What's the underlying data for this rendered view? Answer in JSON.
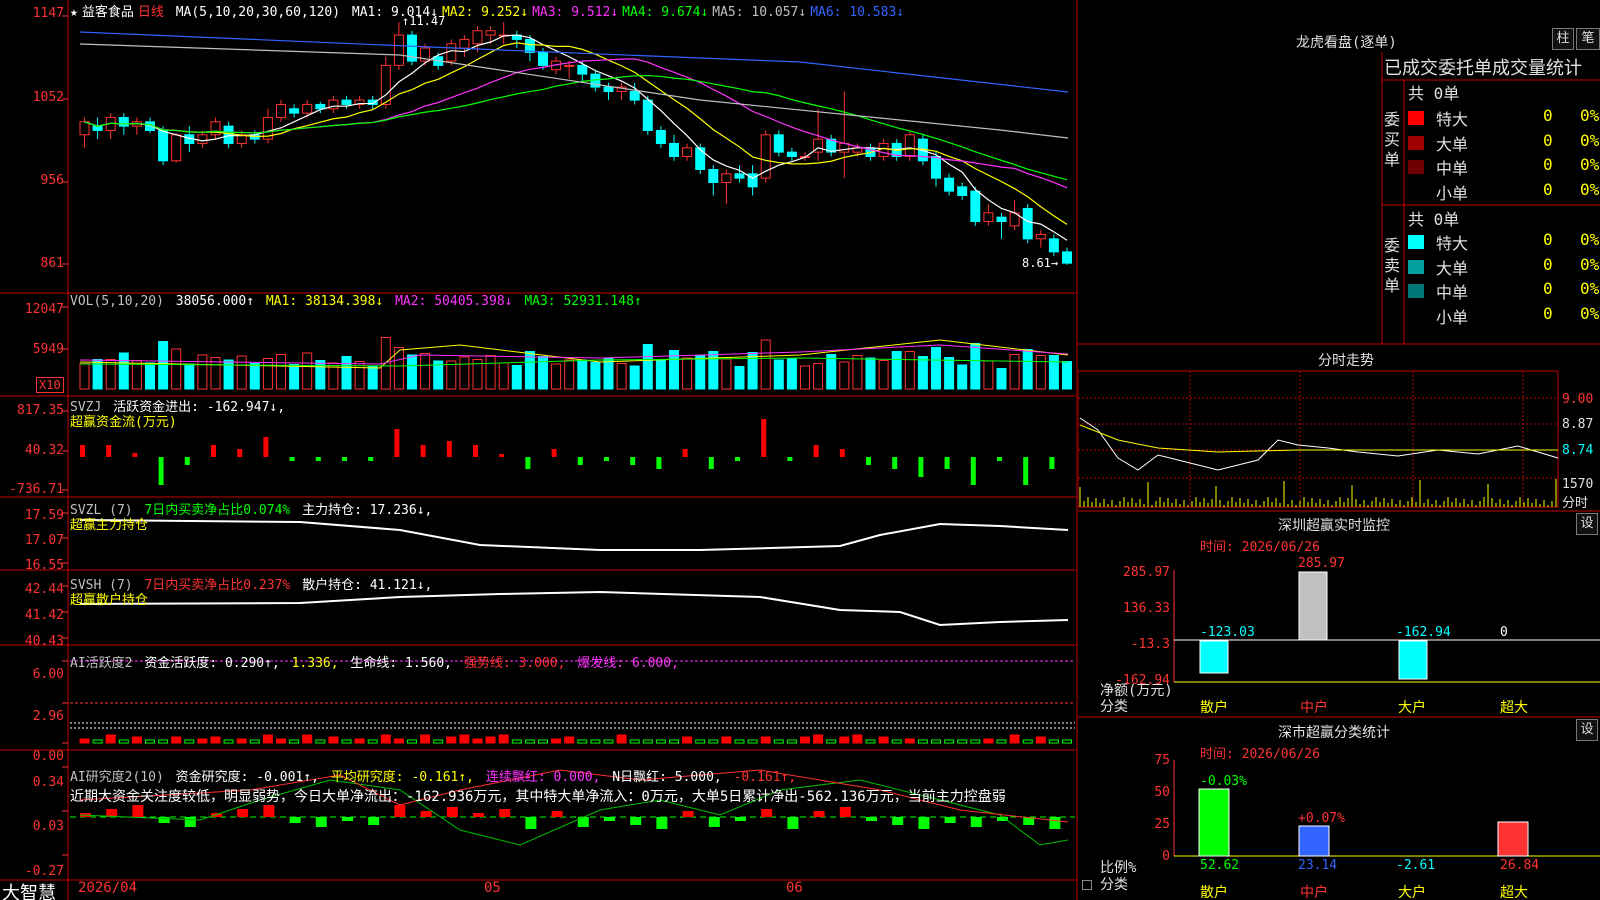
{
  "main_header": {
    "star": "★",
    "stock_name": "益客食品",
    "period": "日线",
    "ma_label": "MA(5,10,20,30,60,120)",
    "ma": [
      {
        "text": "MA1: 9.014↓",
        "color": "#ffffff"
      },
      {
        "text": "MA2: 9.252↓",
        "color": "#ffff00"
      },
      {
        "text": "MA3: 9.512↓",
        "color": "#ff32ff"
      },
      {
        "text": "MA4: 9.674↓",
        "color": "#00ff00"
      },
      {
        "text": "MA5: 10.057↓",
        "color": "#c0c0c0"
      },
      {
        "text": "MA6: 10.583↓",
        "color": "#3264ff"
      }
    ],
    "high_marker": "11.47",
    "low_marker": "8.61"
  },
  "price_axis": [
    "1147",
    "1052",
    "956",
    "861"
  ],
  "vol_panel": {
    "label": "VOL(5,10,20)",
    "value": "38056.000↑",
    "ma1": "MA1: 38134.398↓",
    "ma2": "MA2: 50405.398↓",
    "ma3": "MA3: 52931.148↑",
    "axis": [
      "12047",
      "5949"
    ],
    "unit": "X10"
  },
  "svzj_panel": {
    "label": "SVZJ",
    "title": "活跃资金进出: -162.947↓,",
    "subtitle": "超赢资金流(万元)",
    "axis": [
      "817.35",
      "40.32",
      "-736.71"
    ]
  },
  "svzl_panel": {
    "label": "SVZL (7)",
    "ratio": "7日内买卖净占比0.074%",
    "hold": "主力持仓: 17.236↓,",
    "subtitle": "超赢主力持仓",
    "axis": [
      "17.59",
      "17.07",
      "16.55"
    ]
  },
  "svsh_panel": {
    "label": "SVSH (7)",
    "ratio": "7日内买卖净占比0.237%",
    "hold": "散户持仓: 41.121↓,",
    "subtitle": "超赢散户持仓",
    "axis": [
      "42.44",
      "41.42",
      "40.43"
    ]
  },
  "ai_active_panel": {
    "label": "AI活跃度2",
    "active": "资金活跃度: 0.290↑,",
    "v2": "1.336,",
    "life": "生命线: 1.560,",
    "strong": "强势线: 3.000,",
    "burst": "爆发线: 6.000,",
    "axis": [
      "6.00",
      "2.96",
      "0.00"
    ]
  },
  "ai_research_panel": {
    "label": "AI研究度2(10)",
    "research": "资金研究度: -0.001↑,",
    "avg": "平均研究度: -0.161↑,",
    "cont": "连续飘红: 0.000,",
    "nday": "N日飘红: 5.000,",
    "last": "-0.161↑,",
    "comment": "近期大资金关注度较低，明显弱势，今日大单净流出：-162.936万元，其中特大单净流入：0万元，大单5日累计净出-562.136万元，当前主力控盘弱",
    "axis": [
      "0.34",
      "0.03",
      "-0.27"
    ]
  },
  "bottom_bar": {
    "brand": "大智慧",
    "date_label": "2026/04",
    "months": [
      "05",
      "06"
    ]
  },
  "right_panel": {
    "longhu_title": "龙虎看盘(逐单)",
    "btn_bar": "柱",
    "btn_pen": "笔",
    "table_header": "已成交委托单成交量统计",
    "buy_side": {
      "label": "委买单",
      "total": "共 0单",
      "rows": [
        {
          "name": "特大",
          "v": "0",
          "pct": "0%",
          "color": "#ff0000"
        },
        {
          "name": "大单",
          "v": "0",
          "pct": "0%",
          "color": "#a00000"
        },
        {
          "name": "中单",
          "v": "0",
          "pct": "0%",
          "color": "#700000"
        },
        {
          "name": "小单",
          "v": "0",
          "pct": "0%",
          "color": "#000000"
        }
      ]
    },
    "sell_side": {
      "label": "委卖单",
      "total": "共 0单",
      "rows": [
        {
          "name": "特大",
          "v": "0",
          "pct": "0%",
          "color": "#00ffff"
        },
        {
          "name": "大单",
          "v": "0",
          "pct": "0%",
          "color": "#00a0a0"
        },
        {
          "name": "中单",
          "v": "0",
          "pct": "0%",
          "color": "#007878"
        },
        {
          "name": "小单",
          "v": "0",
          "pct": "0%",
          "color": "#000000"
        }
      ]
    },
    "intraday_title": "分时走势",
    "intraday_axis": [
      "9.00",
      "8.87",
      "8.74"
    ],
    "intraday_vol": "1570",
    "intraday_vol_unit": "分时",
    "monitor_title": "深圳超赢实时监控",
    "monitor_btn": "设",
    "monitor_time": "时间: 2026/06/26",
    "monitor_axis": [
      "285.97",
      "136.33",
      "-13.3",
      "-162.94"
    ],
    "monitor_values": [
      {
        "label": "-123.03",
        "color": "#00ffff"
      },
      {
        "label": "285.97",
        "color": "#ff3232"
      },
      {
        "label": "-162.94",
        "color": "#00ffff"
      },
      {
        "label": "0",
        "color": "#ffffff"
      }
    ],
    "monitor_ylabel": "净额(万元)",
    "monitor_xlabel": "分类",
    "categories": [
      {
        "name": "散户",
        "color": "#ffff00"
      },
      {
        "name": "中户",
        "color": "#ff3232"
      },
      {
        "name": "大户",
        "color": "#ffff00"
      },
      {
        "name": "超大",
        "color": "#ffff00"
      }
    ],
    "stats_title": "深市超赢分类统计",
    "stats_btn": "设",
    "stats_time": "时间: 2026/06/26",
    "stats_axis": [
      "75",
      "50",
      "25",
      "0"
    ],
    "stats_top": [
      {
        "label": "-0.03%",
        "color": "#00ff00"
      },
      {
        "label": "+0.07%",
        "color": "#ff3232"
      }
    ],
    "stats_values": [
      {
        "label": "52.62",
        "color": "#00ff00"
      },
      {
        "label": "23.14",
        "color": "#3264ff"
      },
      {
        "label": "-2.61",
        "color": "#00ffff"
      },
      {
        "label": "26.84",
        "color": "#ff3232"
      }
    ],
    "stats_ylabel": "比例%",
    "stats_xlabel": "分类"
  },
  "chart_data": {
    "type": "candlestick",
    "note_series": "daily OHLC (price units, x100 axis)",
    "candles": [
      [
        1010,
        1025,
        995,
        1030
      ],
      [
        1020,
        1015,
        1005,
        1030
      ],
      [
        1015,
        1030,
        1005,
        1035
      ],
      [
        1030,
        1020,
        1010,
        1035
      ],
      [
        1020,
        1025,
        1010,
        1030
      ],
      [
        1025,
        1015,
        1012,
        1030
      ],
      [
        1015,
        980,
        975,
        1020
      ],
      [
        980,
        1010,
        978,
        1012
      ],
      [
        1010,
        1000,
        990,
        1020
      ],
      [
        1000,
        1010,
        995,
        1015
      ],
      [
        1010,
        1025,
        1005,
        1030
      ],
      [
        1020,
        1000,
        995,
        1025
      ],
      [
        1000,
        1010,
        995,
        1015
      ],
      [
        1010,
        1005,
        1000,
        1015
      ],
      [
        1005,
        1030,
        1000,
        1040
      ],
      [
        1030,
        1045,
        1025,
        1050
      ],
      [
        1040,
        1035,
        1030,
        1045
      ],
      [
        1035,
        1045,
        1030,
        1050
      ],
      [
        1045,
        1040,
        1035,
        1048
      ],
      [
        1040,
        1050,
        1035,
        1055
      ],
      [
        1050,
        1045,
        1040,
        1055
      ],
      [
        1045,
        1050,
        1040,
        1055
      ],
      [
        1050,
        1045,
        1040,
        1055
      ],
      [
        1045,
        1090,
        1040,
        1100
      ],
      [
        1090,
        1125,
        1085,
        1140
      ],
      [
        1125,
        1095,
        1090,
        1130
      ],
      [
        1095,
        1110,
        1090,
        1115
      ],
      [
        1100,
        1090,
        1085,
        1105
      ],
      [
        1095,
        1115,
        1090,
        1120
      ],
      [
        1110,
        1120,
        1100,
        1125
      ],
      [
        1115,
        1130,
        1105,
        1135
      ],
      [
        1125,
        1130,
        1115,
        1135
      ],
      [
        1125,
        1125,
        1115,
        1140
      ],
      [
        1125,
        1120,
        1110,
        1130
      ],
      [
        1120,
        1105,
        1095,
        1125
      ],
      [
        1105,
        1090,
        1085,
        1110
      ],
      [
        1085,
        1095,
        1080,
        1100
      ],
      [
        1090,
        1090,
        1075,
        1095
      ],
      [
        1090,
        1080,
        1070,
        1095
      ],
      [
        1080,
        1065,
        1060,
        1085
      ],
      [
        1065,
        1060,
        1050,
        1070
      ],
      [
        1060,
        1065,
        1050,
        1070
      ],
      [
        1060,
        1050,
        1045,
        1070
      ],
      [
        1050,
        1015,
        1010,
        1055
      ],
      [
        1015,
        1000,
        995,
        1020
      ],
      [
        1000,
        985,
        980,
        1010
      ],
      [
        985,
        995,
        980,
        1000
      ],
      [
        995,
        970,
        965,
        1000
      ],
      [
        970,
        955,
        940,
        975
      ],
      [
        955,
        965,
        930,
        970
      ],
      [
        965,
        960,
        955,
        975
      ],
      [
        965,
        950,
        940,
        975
      ],
      [
        960,
        1010,
        955,
        1015
      ],
      [
        1010,
        990,
        985,
        1015
      ],
      [
        990,
        985,
        980,
        995
      ],
      [
        985,
        985,
        980,
        990
      ],
      [
        990,
        1005,
        980,
        1040
      ],
      [
        1005,
        990,
        985,
        1010
      ],
      [
        990,
        1000,
        960,
        1060
      ],
      [
        990,
        995,
        985,
        1000
      ],
      [
        995,
        985,
        980,
        1000
      ],
      [
        985,
        1000,
        980,
        1005
      ],
      [
        1000,
        985,
        980,
        1005
      ],
      [
        985,
        1010,
        980,
        1015
      ],
      [
        1005,
        980,
        975,
        1010
      ],
      [
        985,
        960,
        950,
        990
      ],
      [
        960,
        945,
        940,
        965
      ],
      [
        950,
        940,
        935,
        955
      ],
      [
        945,
        910,
        905,
        950
      ],
      [
        910,
        920,
        905,
        930
      ],
      [
        915,
        910,
        890,
        920
      ],
      [
        905,
        920,
        900,
        935
      ],
      [
        925,
        890,
        885,
        930
      ],
      [
        890,
        895,
        880,
        900
      ],
      [
        890,
        875,
        870,
        895
      ],
      [
        875,
        862,
        860,
        880
      ]
    ]
  }
}
